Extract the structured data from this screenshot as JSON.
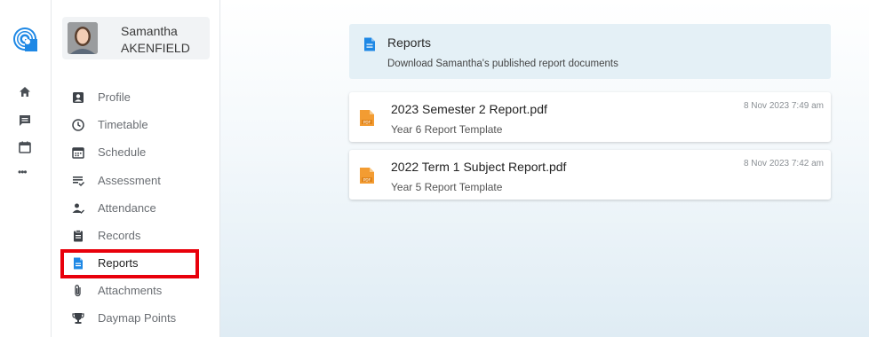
{
  "rail": {
    "logo": "daymap-logo-icon",
    "icons": [
      "home-icon",
      "message-icon",
      "calendar-icon",
      "more-icon"
    ],
    "more_glyph": "•••"
  },
  "student": {
    "first_name": "Samantha",
    "last_name": "AKENFIELD"
  },
  "nav": {
    "items": [
      {
        "label": "Profile",
        "icon": "profile-icon"
      },
      {
        "label": "Timetable",
        "icon": "clock-icon"
      },
      {
        "label": "Schedule",
        "icon": "calendar-grid-icon"
      },
      {
        "label": "Assessment",
        "icon": "assessment-list-icon"
      },
      {
        "label": "Attendance",
        "icon": "attendance-icon"
      },
      {
        "label": "Records",
        "icon": "clipboard-icon"
      },
      {
        "label": "Reports",
        "icon": "document-icon",
        "active": true
      },
      {
        "label": "Attachments",
        "icon": "paperclip-icon"
      },
      {
        "label": "Daymap Points",
        "icon": "trophy-icon"
      }
    ]
  },
  "reports": {
    "title": "Reports",
    "subtitle": "Download Samantha's published report documents",
    "documents": [
      {
        "name": "2023 Semester 2 Report.pdf",
        "template": "Year 6 Report Template",
        "date": "8 Nov 2023 7:49 am"
      },
      {
        "name": "2022 Term 1 Subject Report.pdf",
        "template": "Year 5 Report Template",
        "date": "8 Nov 2023 7:42 am"
      }
    ]
  },
  "colors": {
    "accent": "#1e88e5",
    "highlight": "#e8000b",
    "pdf": "#f39c32",
    "header_bg": "#e4f0f6"
  }
}
